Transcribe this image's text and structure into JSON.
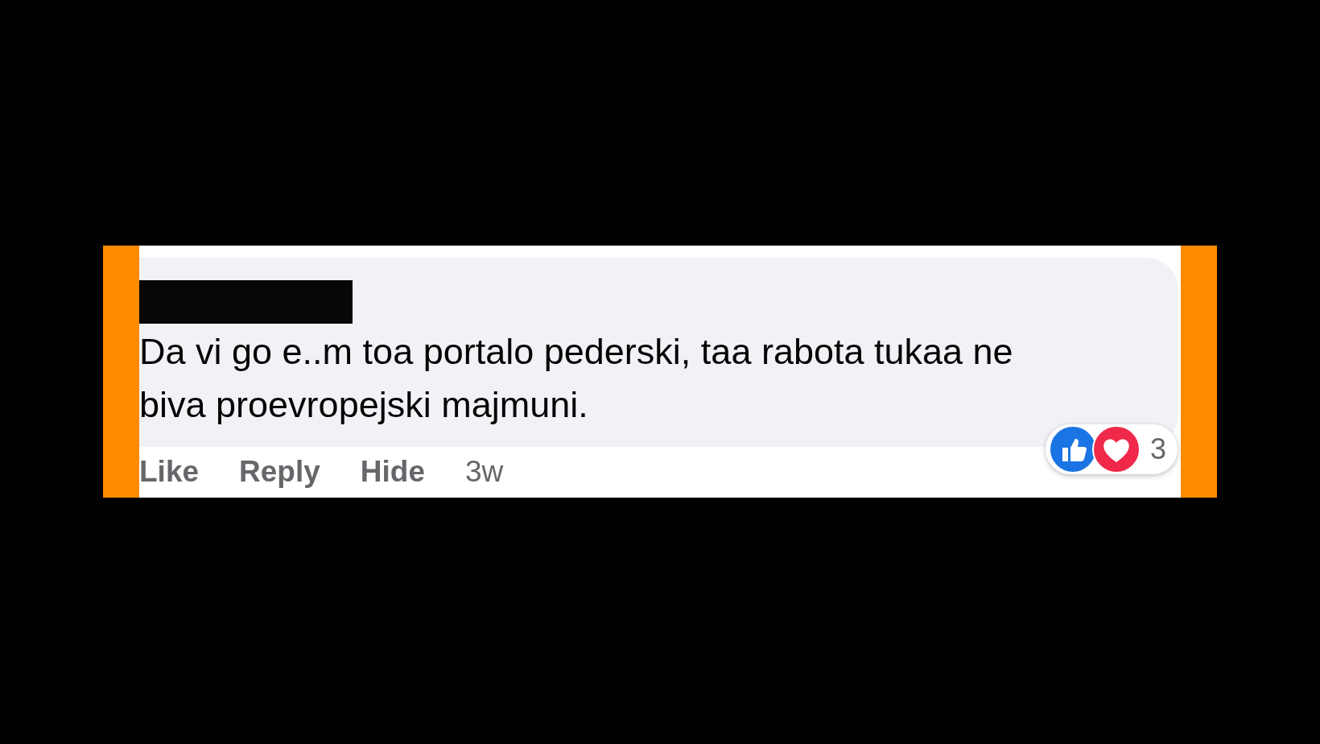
{
  "comment": {
    "text": "Da vi go e..m toa portalo pederski, taa rabota tukaa ne biva proevropejski majmuni.",
    "actions": [
      {
        "label": "Like"
      },
      {
        "label": "Reply"
      },
      {
        "label": "Hide"
      }
    ],
    "time": "3w",
    "reactions": {
      "count": "3"
    }
  }
}
